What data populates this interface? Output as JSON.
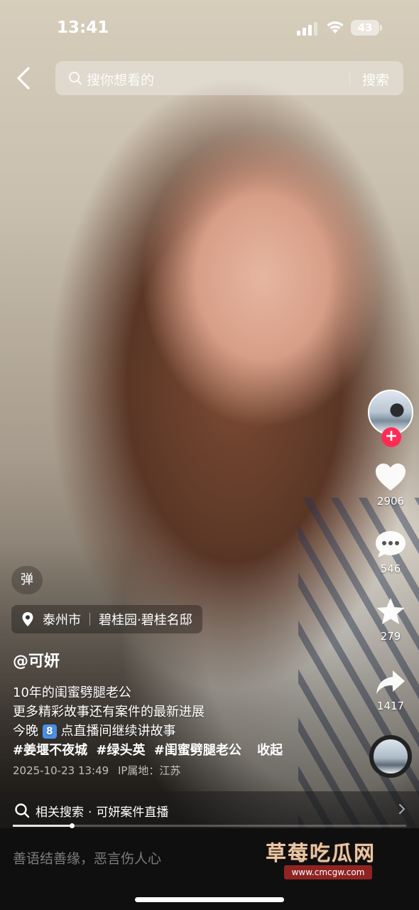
{
  "status_bar": {
    "time": "13:41",
    "battery": "43"
  },
  "search": {
    "placeholder": "搜你想看的",
    "button_label": "搜索"
  },
  "actions": {
    "likes": "2906",
    "comments": "546",
    "favorites": "279",
    "shares": "1417",
    "follow_symbol": "+"
  },
  "danmu_label": "弹",
  "location": {
    "city": "泰州市",
    "place": "碧桂园·碧桂名邸"
  },
  "post": {
    "author": "@可妍",
    "caption_lines": [
      "10年的闺蜜劈腿老公",
      "更多精彩故事还有案件的最新进展"
    ],
    "caption_line3_prefix": "今晚",
    "caption_line3_keycap": "8",
    "caption_line3_suffix": "点直播间继续讲故事",
    "hashtags": [
      "#姜堰不夜城",
      "#绿头英",
      "#闺蜜劈腿老公"
    ],
    "collapse_label": "收起",
    "date": "2025-10-23 13:49",
    "ip_location": "IP属地：江苏"
  },
  "related_search": {
    "label": "相关搜索",
    "separator": "·",
    "query": "可妍案件直播"
  },
  "progress": 0.15,
  "comment_bar": {
    "placeholder": "善语结善缘，恶言伤人心"
  },
  "watermark": {
    "title": "草莓吃瓜网",
    "url": "www.cmcgw.com"
  },
  "colors": {
    "follow_accent": "#fe2c55",
    "watermark_text": "#e7c8a4",
    "watermark_badge": "#8f2422"
  }
}
